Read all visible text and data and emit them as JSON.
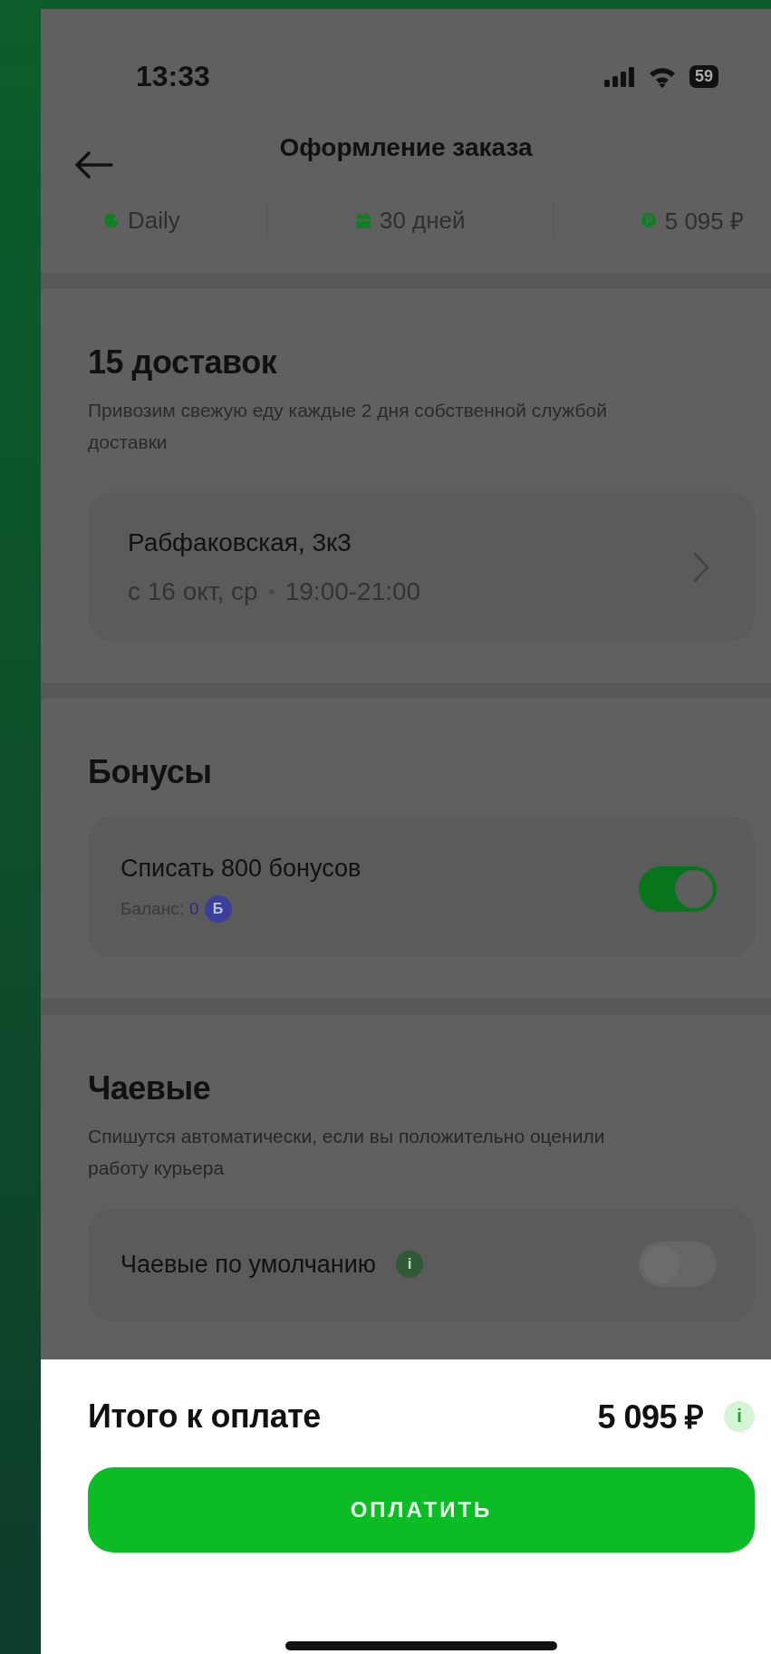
{
  "status_bar": {
    "time": "13:33",
    "battery": "59"
  },
  "header": {
    "title": "Оформление заказа"
  },
  "summary": [
    {
      "kind": "plan",
      "label": "Daily"
    },
    {
      "kind": "duration",
      "label": "30 дней"
    },
    {
      "kind": "price",
      "label": "5 095 ₽"
    }
  ],
  "delivery": {
    "title": "15 доставок",
    "description": "Привозим свежую еду каждые 2 дня собственной службой доставки",
    "address": "Рабфаковская, 3к3",
    "date": "с 16 окт, ср",
    "time": "19:00-21:00"
  },
  "bonuses": {
    "title": "Бонусы",
    "label": "Списать 800 бонусов",
    "balance_label": "Баланс:",
    "balance_value": "0",
    "badge": "Б",
    "on": true
  },
  "tips": {
    "title": "Чаевые",
    "description": "Спишутся автоматически, если вы положительно оценили работу курьера",
    "label": "Чаевые по умолчанию",
    "info": "i",
    "on": false
  },
  "footer": {
    "total_label": "Итого к оплате",
    "total": "5 095 ₽",
    "info": "i",
    "pay_button": "ОПЛАТИТЬ"
  }
}
